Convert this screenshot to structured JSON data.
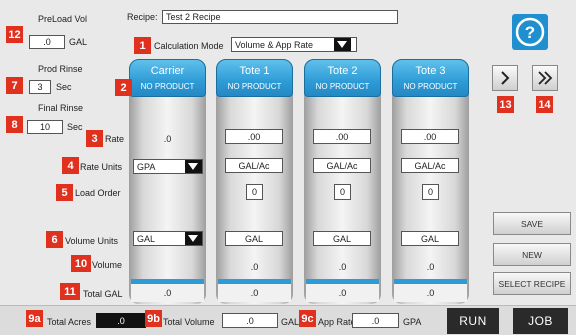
{
  "preload": {
    "label": "PreLoad Vol",
    "value": ".0",
    "unit": "GAL",
    "badge": "12"
  },
  "recipe": {
    "label": "Recipe:",
    "value": "Test 2 Recipe"
  },
  "help_icon": "question-circle",
  "calc_mode": {
    "badge": "1",
    "label": "Calculation Mode",
    "value": "Volume & App Rate"
  },
  "prod_rinse": {
    "label": "Prod Rinse",
    "value": "3",
    "unit": "Sec",
    "badge": "7"
  },
  "final_rinse": {
    "label": "Final Rinse",
    "value": "10",
    "unit": "Sec",
    "badge": "8"
  },
  "row_labels": {
    "rate": {
      "badge": "3",
      "text": "Rate"
    },
    "rate_units": {
      "badge": "4",
      "text": "Rate Units"
    },
    "load_order": {
      "badge": "5",
      "text": "Load Order"
    },
    "volume_units": {
      "badge": "6",
      "text": "Volume Units"
    },
    "volume": {
      "badge": "10",
      "text": "Volume"
    },
    "total_gal": {
      "badge": "11",
      "text": "Total GAL"
    }
  },
  "carrier_badge": "2",
  "columns": [
    {
      "name": "Carrier",
      "product": "NO PRODUCT",
      "rate": ".0",
      "rate_units": "GPA",
      "load_order": "",
      "volume_units": "GAL",
      "volume": "",
      "total": ".0"
    },
    {
      "name": "Tote 1",
      "product": "NO PRODUCT",
      "rate": ".00",
      "rate_units": "GAL/Ac",
      "load_order": "0",
      "volume_units": "GAL",
      "volume": ".0",
      "total": ".0"
    },
    {
      "name": "Tote 2",
      "product": "NO PRODUCT",
      "rate": ".00",
      "rate_units": "GAL/Ac",
      "load_order": "0",
      "volume_units": "GAL",
      "volume": ".0",
      "total": ".0"
    },
    {
      "name": "Tote 3",
      "product": "NO PRODUCT",
      "rate": ".00",
      "rate_units": "GAL/Ac",
      "load_order": "0",
      "volume_units": "GAL",
      "volume": ".0",
      "total": ".0"
    }
  ],
  "nav": {
    "next_badge": "13",
    "last_badge": "14"
  },
  "side_buttons": {
    "save": "SAVE",
    "new": "NEW",
    "select_recipe": "SELECT RECIPE"
  },
  "bottom": {
    "total_acres": {
      "badge": "9a",
      "label": "Total Acres",
      "value": ".0"
    },
    "total_volume": {
      "badge": "9b",
      "label": "Total Volume",
      "value": ".0",
      "unit": "GAL"
    },
    "app_rate": {
      "badge": "9c",
      "label": "App Rate",
      "value": ".0",
      "unit": "GPA"
    },
    "run": "RUN",
    "job": "JOB"
  },
  "colors": {
    "header_blue": "#2e9bd6",
    "badge_red": "#e0301e",
    "dark_button": "#2a2a2a",
    "help_blue": "#1f8fd0"
  }
}
